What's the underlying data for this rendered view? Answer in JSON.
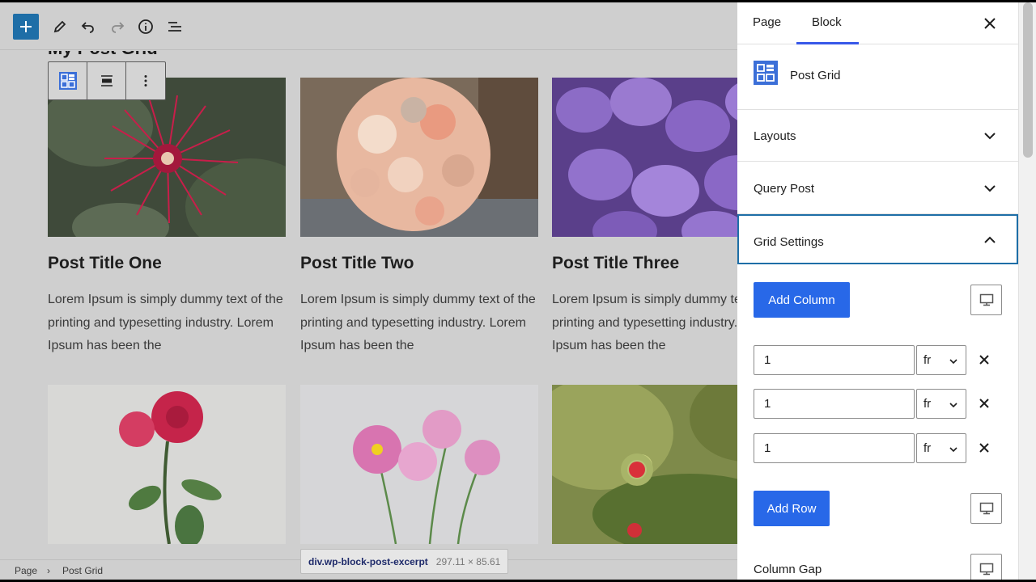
{
  "editor": {
    "page_heading": "My Post Grid",
    "posts": [
      {
        "title": "Post Title One",
        "excerpt": "Lorem Ipsum is simply dummy text of the printing and typesetting industry. Lorem Ipsum has been the"
      },
      {
        "title": "Post Title Two",
        "excerpt": "Lorem Ipsum is simply dummy text of the printing and typesetting industry. Lorem Ipsum has been the"
      },
      {
        "title": "Post Title Three",
        "excerpt": "Lorem Ipsum is simply dummy text of the printing and typesetting industry. Lorem Ipsum has been the"
      }
    ],
    "images": [
      "red-protea-flower",
      "peach-rose-bouquet",
      "purple-hydrangea",
      "pink-rose",
      "pink-cosmos-flowers",
      "red-wildflowers"
    ]
  },
  "breadcrumb": {
    "page": "Page",
    "separator": "›",
    "current": "Post Grid"
  },
  "tooltip": {
    "selector": "div.wp-block-post-excerpt",
    "dimensions": "297.11 × 85.61"
  },
  "sidebar": {
    "tabs": {
      "page": "Page",
      "block": "Block"
    },
    "block_name": "Post Grid",
    "panels": {
      "layouts": "Layouts",
      "query": "Query Post",
      "grid": "Grid Settings"
    },
    "add_column_label": "Add Column",
    "add_row_label": "Add Row",
    "columns": [
      {
        "value": "1",
        "unit": "fr"
      },
      {
        "value": "1",
        "unit": "fr"
      },
      {
        "value": "1",
        "unit": "fr"
      }
    ],
    "column_gap_label": "Column Gap"
  },
  "colors": {
    "primary": "#2868e8",
    "focus": "#1e6ea7",
    "tab_underline": "#3858e9"
  }
}
